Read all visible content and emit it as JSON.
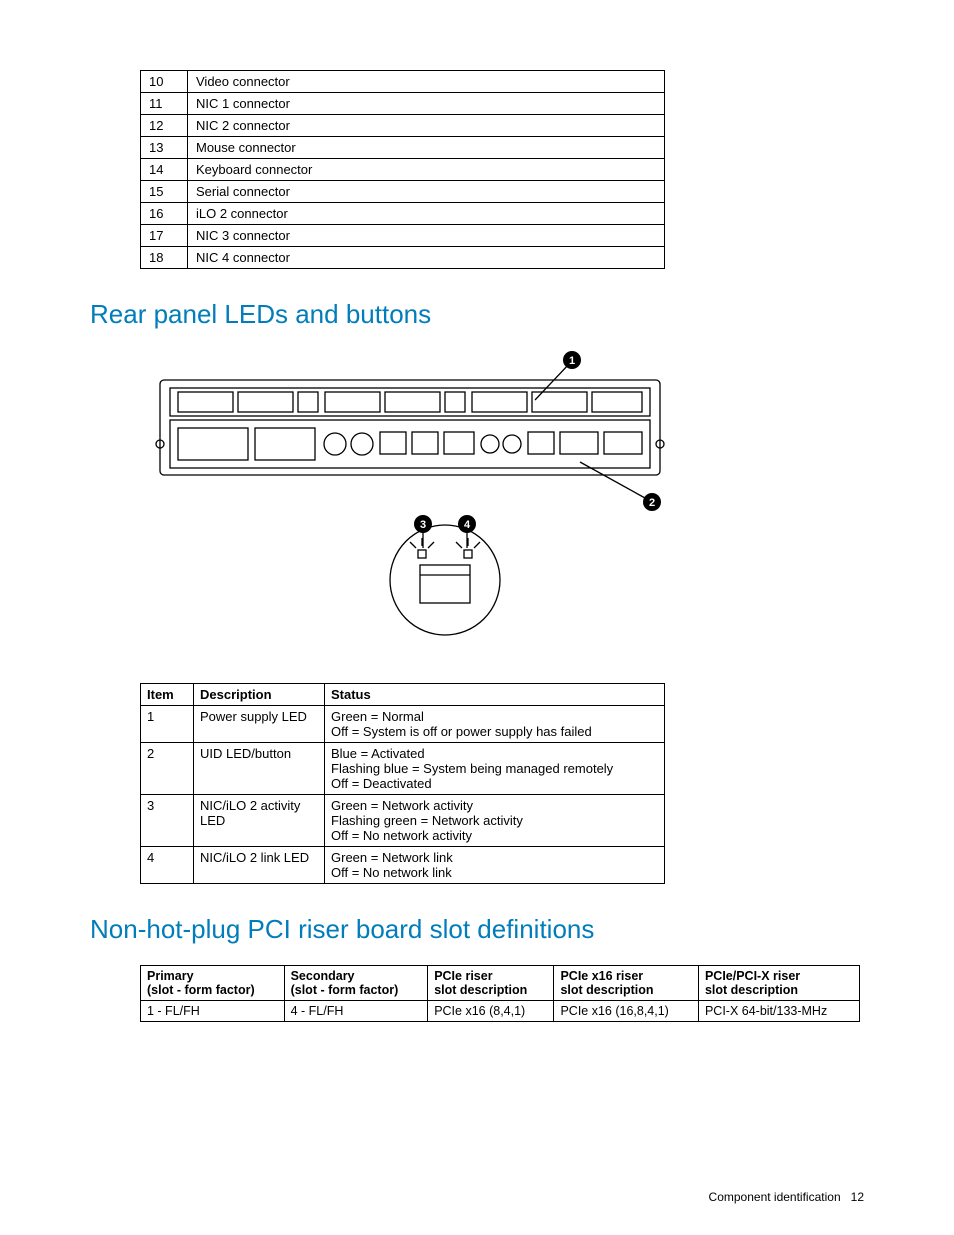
{
  "connectors_table": {
    "rows": [
      {
        "num": "10",
        "desc": "Video connector"
      },
      {
        "num": "11",
        "desc": "NIC 1 connector"
      },
      {
        "num": "12",
        "desc": "NIC 2 connector"
      },
      {
        "num": "13",
        "desc": "Mouse connector"
      },
      {
        "num": "14",
        "desc": "Keyboard connector"
      },
      {
        "num": "15",
        "desc": "Serial connector"
      },
      {
        "num": "16",
        "desc": "iLO 2 connector"
      },
      {
        "num": "17",
        "desc": "NIC 3 connector"
      },
      {
        "num": "18",
        "desc": "NIC 4 connector"
      }
    ]
  },
  "headings": {
    "rear_panel": "Rear panel LEDs and buttons",
    "pci_riser": "Non-hot-plug PCI riser board slot definitions"
  },
  "led_table": {
    "headers": {
      "item": "Item",
      "description": "Description",
      "status": "Status"
    },
    "rows": [
      {
        "item": "1",
        "desc": "Power supply LED",
        "status": "Green = Normal\nOff = System is off or power supply has failed"
      },
      {
        "item": "2",
        "desc": "UID LED/button",
        "status": "Blue = Activated\nFlashing blue = System being managed remotely\nOff = Deactivated"
      },
      {
        "item": "3",
        "desc": "NIC/iLO 2 activity LED",
        "status": "Green = Network activity\nFlashing green = Network activity\nOff = No network activity"
      },
      {
        "item": "4",
        "desc": "NIC/iLO 2 link LED",
        "status": "Green = Network link\nOff = No network link"
      }
    ]
  },
  "pci_table": {
    "headers": {
      "primary": "Primary\n(slot - form factor)",
      "secondary": "Secondary\n(slot - form factor)",
      "pcie": "PCIe riser\nslot description",
      "pcie16": "PCIe x16 riser\nslot description",
      "pcipcix": "PCIe/PCI-X riser\nslot description"
    },
    "rows": [
      {
        "primary": "1 - FL/FH",
        "secondary": "4 - FL/FH",
        "pcie": "PCIe x16 (8,4,1)",
        "pcie16": "PCIe x16 (16,8,4,1)",
        "pcipcix": "PCI-X 64-bit/133-MHz"
      }
    ]
  },
  "callouts": {
    "c1": "1",
    "c2": "2",
    "c3": "3",
    "c4": "4"
  },
  "footer": {
    "section": "Component identification",
    "page": "12"
  }
}
